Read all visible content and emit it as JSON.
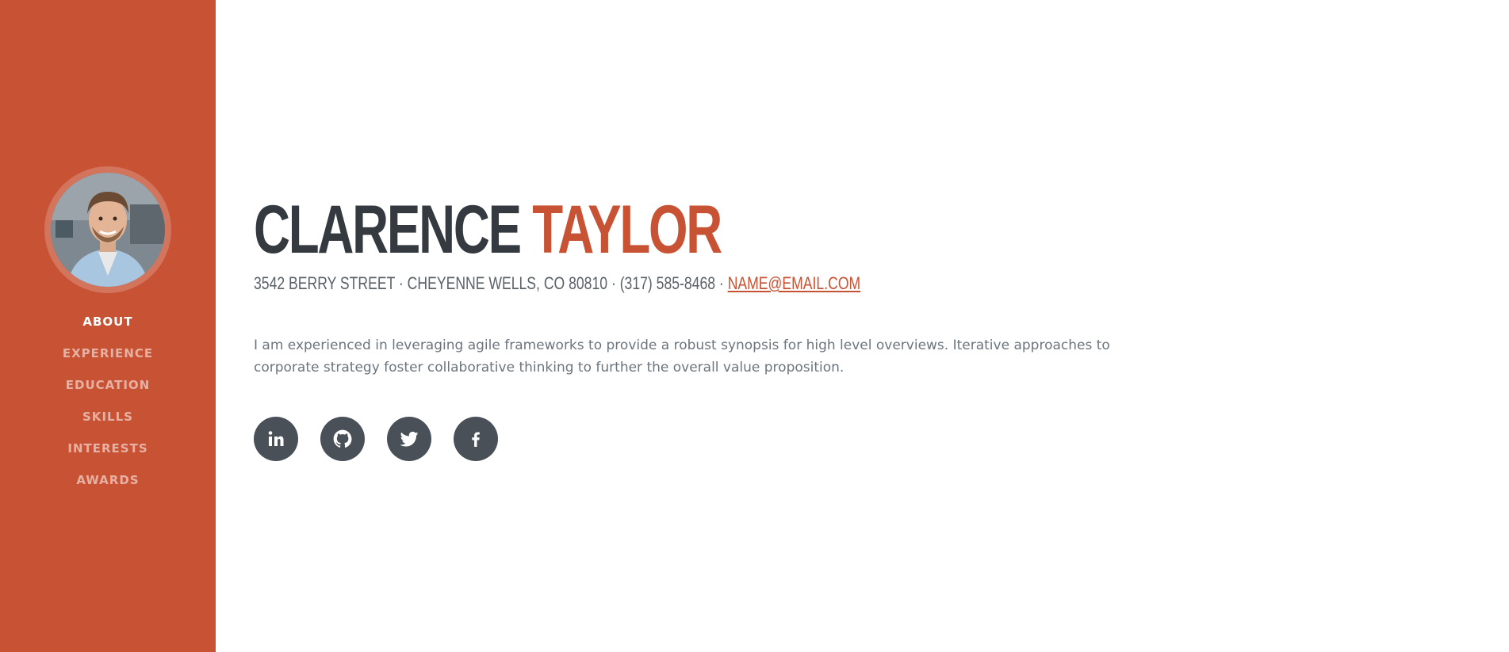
{
  "profile": {
    "avatar_alt": "Profile photo"
  },
  "nav": {
    "items": [
      {
        "label": "ABOUT",
        "active": true
      },
      {
        "label": "EXPERIENCE",
        "active": false
      },
      {
        "label": "EDUCATION",
        "active": false
      },
      {
        "label": "SKILLS",
        "active": false
      },
      {
        "label": "INTERESTS",
        "active": false
      },
      {
        "label": "AWARDS",
        "active": false
      }
    ]
  },
  "about": {
    "first_name": "CLARENCE",
    "last_name": "TAYLOR",
    "address": "3542 BERRY STREET · CHEYENNE WELLS, CO 80810 · (317) 585-8468 · ",
    "email": "NAME@EMAIL.COM",
    "bio": "I am experienced in leveraging agile frameworks to provide a robust synopsis for high level overviews. Iterative approaches to corporate strategy foster collaborative thinking to further the overall value proposition."
  },
  "social": [
    {
      "icon": "linkedin-icon"
    },
    {
      "icon": "github-icon"
    },
    {
      "icon": "twitter-icon"
    },
    {
      "icon": "facebook-icon"
    }
  ],
  "colors": {
    "accent": "#c85234",
    "dark": "#343a40",
    "social_bg": "#495057",
    "text_muted": "#6c757d"
  }
}
